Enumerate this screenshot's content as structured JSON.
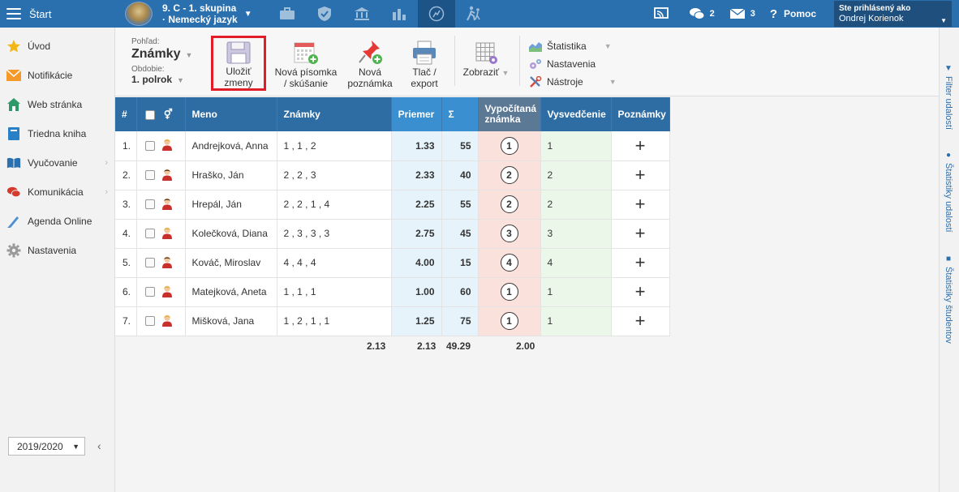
{
  "topbar": {
    "start_label": "Štart",
    "class_line1": "9. C - 1. skupina",
    "class_line2": "· Nemecký jazyk",
    "chat_count": "2",
    "mail_count": "3",
    "help_label": "Pomoc",
    "user_label": "Ste prihlásený ako",
    "user_name": "Ondrej Korienok"
  },
  "sidebar": {
    "items": [
      {
        "label": "Úvod",
        "icon": "star-icon"
      },
      {
        "label": "Notifikácie",
        "icon": "envelope-icon"
      },
      {
        "label": "Web stránka",
        "icon": "house-icon"
      },
      {
        "label": "Triedna kniha",
        "icon": "book-icon"
      },
      {
        "label": "Vyučovanie",
        "icon": "open-book-icon"
      },
      {
        "label": "Komunikácia",
        "icon": "chat-icon"
      },
      {
        "label": "Agenda Online",
        "icon": "pen-icon"
      },
      {
        "label": "Nastavenia",
        "icon": "gear-icon"
      }
    ],
    "year": "2019/2020"
  },
  "toolbar": {
    "view_label": "Pohľad:",
    "view_value": "Známky",
    "period_label": "Obdobie:",
    "period_value": "1. polrok",
    "save_line1": "Uložiť",
    "save_line2": "zmeny",
    "new_exam_line1": "Nová písomka",
    "new_exam_line2": "/ skúšanie",
    "new_note_line1": "Nová",
    "new_note_line2": "poznámka",
    "print_line1": "Tlač /",
    "print_line2": "export",
    "show_label": "Zobraziť",
    "menu": [
      "Štatistika",
      "Nastavenia",
      "Nástroje"
    ]
  },
  "rail": [
    "Filter udalostí",
    "Štatistiky udalostí",
    "Štatistiky študentov"
  ],
  "table": {
    "headers": {
      "num": "#",
      "name": "Meno",
      "grades": "Známky",
      "avg": "Priemer",
      "sum": "Σ",
      "calc_line1": "Vypočítaná",
      "calc_line2": "známka",
      "cert": "Vysvedčenie",
      "notes": "Poznámky"
    },
    "rows": [
      {
        "num": "1.",
        "name": "Andrejková, Anna",
        "grades": "1 , 1 , 2",
        "avg": "1.33",
        "sum": "55",
        "calc": "1",
        "cert": "1",
        "gender": "f"
      },
      {
        "num": "2.",
        "name": "Hraško, Ján",
        "grades": "2 , 2 , 3",
        "avg": "2.33",
        "sum": "40",
        "calc": "2",
        "cert": "2",
        "gender": "m"
      },
      {
        "num": "3.",
        "name": "Hrepál, Ján",
        "grades": "2 , 2 , 1 , 4",
        "avg": "2.25",
        "sum": "55",
        "calc": "2",
        "cert": "2",
        "gender": "m"
      },
      {
        "num": "4.",
        "name": "Kolečková, Diana",
        "grades": "2 , 3 , 3 , 3",
        "avg": "2.75",
        "sum": "45",
        "calc": "3",
        "cert": "3",
        "gender": "f"
      },
      {
        "num": "5.",
        "name": "Kováč, Miroslav",
        "grades": "4 , 4 , 4",
        "avg": "4.00",
        "sum": "15",
        "calc": "4",
        "cert": "4",
        "gender": "m"
      },
      {
        "num": "6.",
        "name": "Matejková, Aneta",
        "grades": "1 , 1 , 1",
        "avg": "1.00",
        "sum": "60",
        "calc": "1",
        "cert": "1",
        "gender": "f"
      },
      {
        "num": "7.",
        "name": "Mišková, Jana",
        "grades": "1 , 2 , 1 , 1",
        "avg": "1.25",
        "sum": "75",
        "calc": "1",
        "cert": "1",
        "gender": "f"
      }
    ],
    "totals": {
      "grades": "2.13",
      "avg": "2.13",
      "sum": "49.29",
      "calc": "2.00"
    }
  }
}
